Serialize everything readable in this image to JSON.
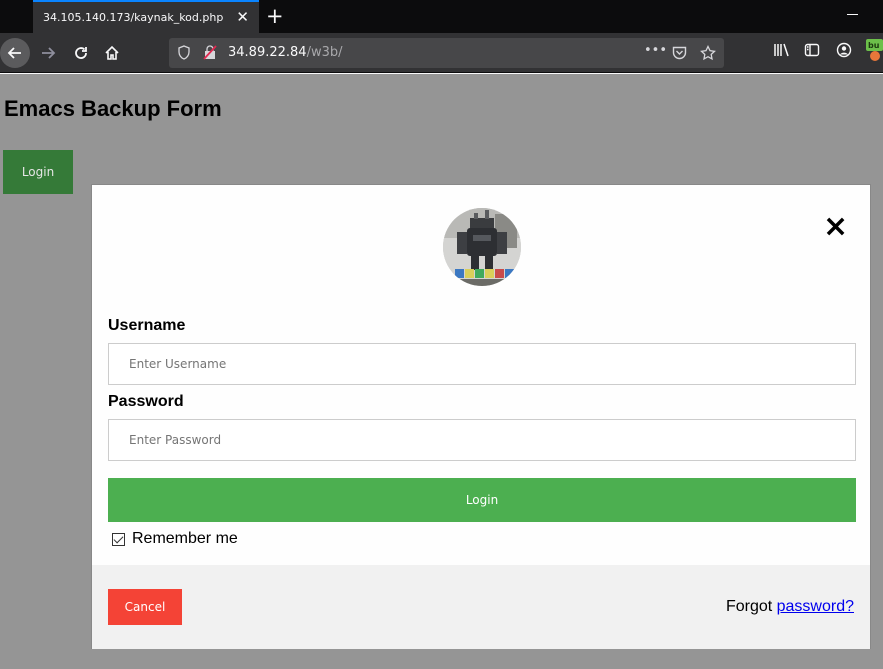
{
  "browser": {
    "tab_title": "34.105.140.173/kaynak_kod.php",
    "tab_close_glyph": "✕",
    "new_tab_glyph": "+",
    "url_host": "34.89.22.84",
    "url_path": "/w3b/",
    "page_actions_glyph": "•••"
  },
  "page": {
    "title": "Emacs Backup Form",
    "open_login_label": "Login"
  },
  "modal": {
    "close_glyph": "×",
    "username_label": "Username",
    "username_placeholder": "Enter Username",
    "password_label": "Password",
    "password_placeholder": "Enter Password",
    "submit_label": "Login",
    "remember_label": "Remember me",
    "remember_checked": true,
    "cancel_label": "Cancel",
    "forgot_text": "Forgot ",
    "forgot_link": "password?"
  },
  "colors": {
    "submit": "#4caf50",
    "cancel": "#f44336",
    "open_login": "#357a38",
    "overlay": "#959595",
    "accent_tab": "#0a84ff"
  }
}
